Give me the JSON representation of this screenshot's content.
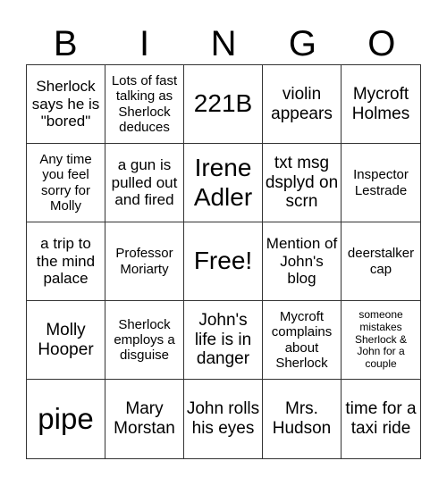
{
  "header": [
    "B",
    "I",
    "N",
    "G",
    "O"
  ],
  "cells": [
    {
      "text": "Sherlock says he is \"bored\"",
      "size": "s-ms"
    },
    {
      "text": "Lots of fast talking as Sherlock deduces",
      "size": "s-s"
    },
    {
      "text": "221B",
      "size": "s-l"
    },
    {
      "text": "violin appears",
      "size": "s-m"
    },
    {
      "text": "Mycroft Holmes",
      "size": "s-m"
    },
    {
      "text": "Any time you feel sorry for Molly",
      "size": "s-s"
    },
    {
      "text": "a gun is pulled out and fired",
      "size": "s-ms"
    },
    {
      "text": "Irene Adler",
      "size": "s-l"
    },
    {
      "text": "txt msg dsplyd on scrn",
      "size": "s-m"
    },
    {
      "text": "Inspector Lestrade",
      "size": "s-s"
    },
    {
      "text": "a trip to the mind palace",
      "size": "s-ms"
    },
    {
      "text": "Professor Moriarty",
      "size": "s-s"
    },
    {
      "text": "Free!",
      "size": "s-l"
    },
    {
      "text": "Mention of John's blog",
      "size": "s-ms"
    },
    {
      "text": "deerstalker cap",
      "size": "s-s"
    },
    {
      "text": "Molly Hooper",
      "size": "s-m"
    },
    {
      "text": "Sherlock employs a disguise",
      "size": "s-s"
    },
    {
      "text": "John's life is in danger",
      "size": "s-m"
    },
    {
      "text": "Mycroft complains about Sherlock",
      "size": "s-s"
    },
    {
      "text": "someone mistakes Sherlock & John for a couple",
      "size": "s-xs"
    },
    {
      "text": "pipe",
      "size": "s-xl"
    },
    {
      "text": "Mary Morstan",
      "size": "s-m"
    },
    {
      "text": "John rolls his eyes",
      "size": "s-m"
    },
    {
      "text": "Mrs. Hudson",
      "size": "s-m"
    },
    {
      "text": "time for a taxi ride",
      "size": "s-m"
    }
  ]
}
